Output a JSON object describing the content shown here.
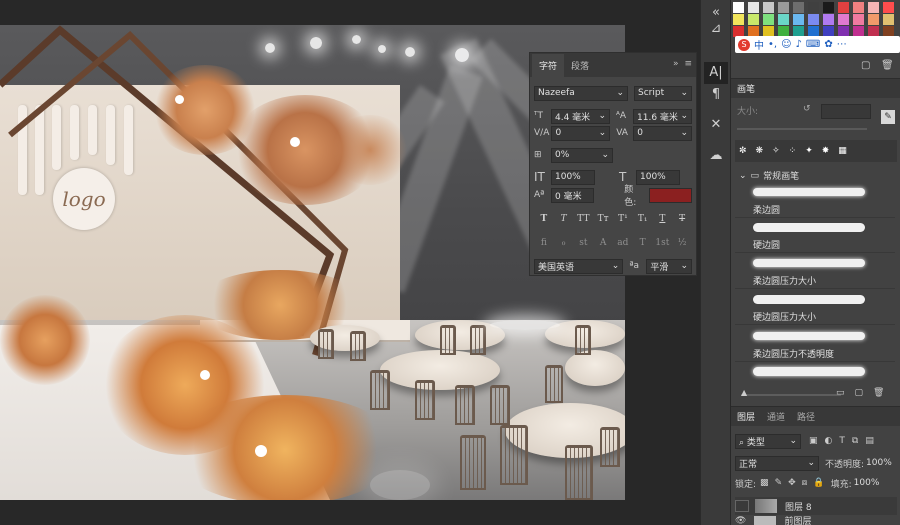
{
  "character_panel": {
    "tabs": [
      "字符",
      "段落"
    ],
    "font_family": "Nazeefa",
    "font_style": "Script",
    "font_size": "4.4 毫米",
    "leading": "11.6 毫米",
    "kerning": "0",
    "tracking": "0",
    "scale_percent": "0%",
    "vertical_scale": "100%",
    "horizontal_scale": "100%",
    "baseline_shift": "0 毫米",
    "color_label": "颜色:",
    "color": "#8b2020",
    "style_buttons": [
      "T",
      "T",
      "TT",
      "Tт",
      "T¹",
      "T₁",
      "T",
      "T"
    ],
    "opentype_buttons": [
      "fi",
      "ℴ",
      "st",
      "A",
      "ad",
      "T",
      "1st",
      "½"
    ],
    "language": "美国英语",
    "aa_label": "ªa",
    "antialias": "平滑"
  },
  "canvas": {
    "logo_text": "logo"
  },
  "ime": {
    "label": "中"
  },
  "brush_panel": {
    "title": "画笔",
    "size_label": "大小:",
    "folder": "常规画笔",
    "brushes": [
      "柔边圆",
      "硬边圆",
      "柔边圆压力大小",
      "硬边圆压力大小",
      "柔边圆压力不透明度"
    ]
  },
  "layers_panel": {
    "tabs": [
      "图层",
      "通道",
      "路径"
    ],
    "filter": "类型",
    "blend_mode": "正常",
    "opacity_label": "不透明度:",
    "opacity": "100%",
    "lock_label": "锁定:",
    "fill_label": "填充:",
    "fill": "100%",
    "layers": [
      "图层 8",
      "前图层"
    ]
  },
  "colors": {
    "panel": "#454545",
    "accent": "#8b2020"
  }
}
